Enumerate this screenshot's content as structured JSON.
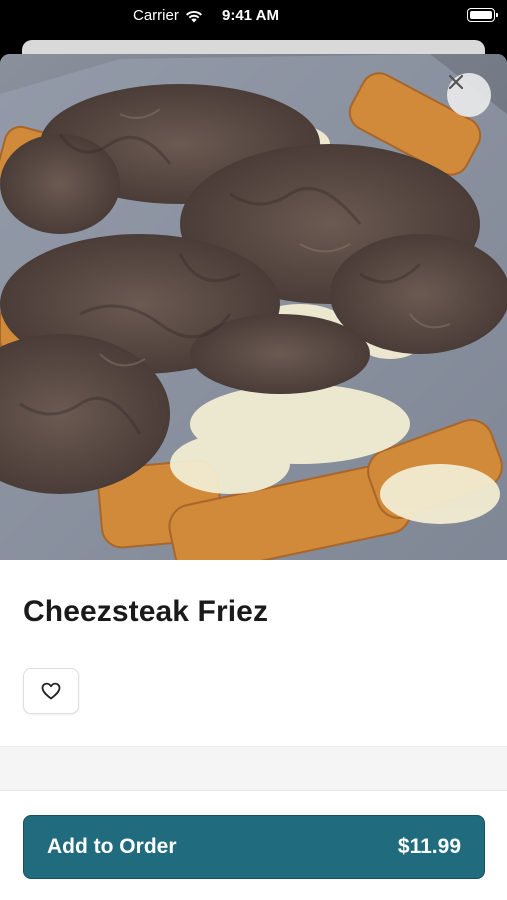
{
  "status_bar": {
    "carrier": "Carrier",
    "time": "9:41 AM"
  },
  "item": {
    "name": "Cheezsteak Friez",
    "image_alt": "Cheesesteak fries topped with shredded beef and cheese sauce"
  },
  "footer": {
    "add_label": "Add to Order",
    "price": "$11.99"
  },
  "colors": {
    "accent": "#216b7e"
  },
  "icons": {
    "close": "close-icon",
    "favorite": "heart-outline-icon"
  }
}
